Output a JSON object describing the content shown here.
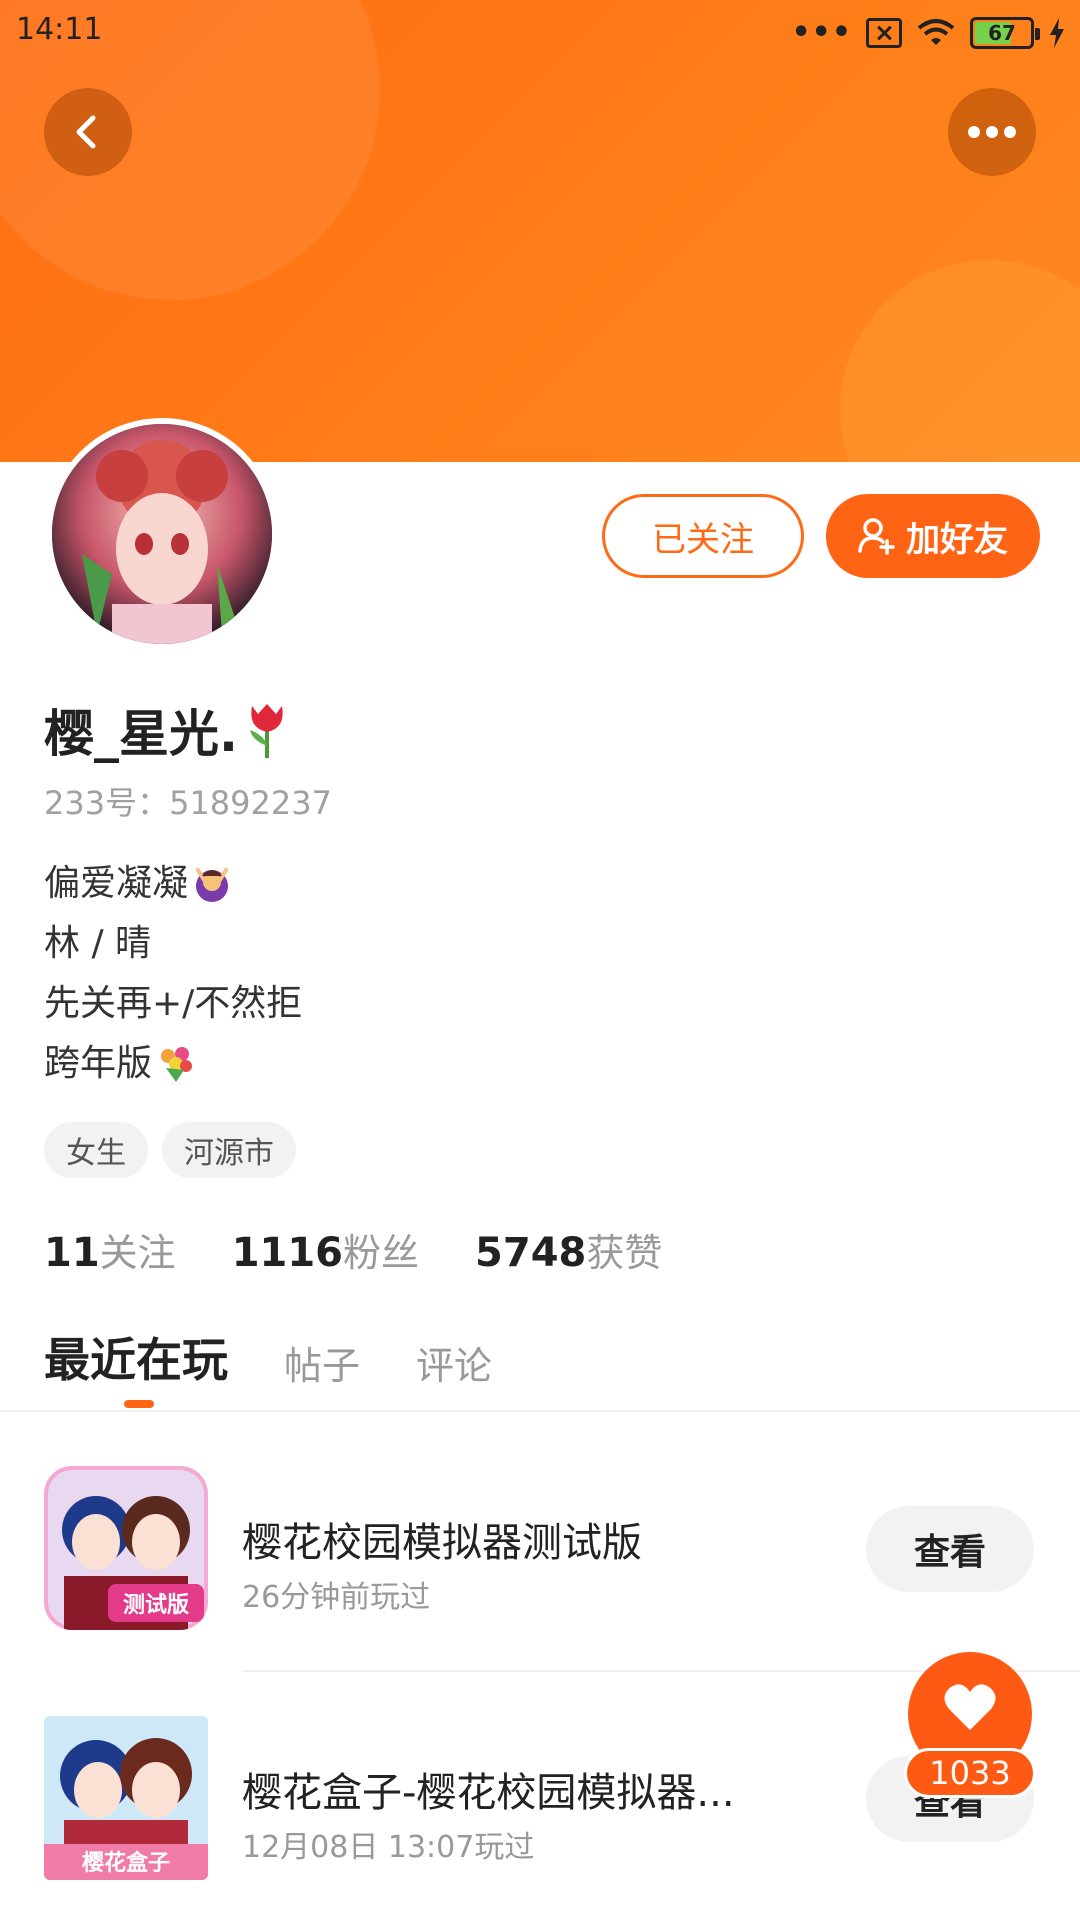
{
  "status_bar": {
    "time": "14:11",
    "battery": "67",
    "signal_dots": "•••"
  },
  "profile": {
    "name": "樱_星光.",
    "id_line": "233号：51892237",
    "bio": [
      "偏爱凝凝",
      "林 / 晴",
      "先关再+/不然拒",
      "跨年版"
    ],
    "tags": [
      "女生",
      "河源市"
    ],
    "follow_label": "已关注",
    "add_friend_label": "加好友"
  },
  "stats": {
    "following": {
      "num": "11",
      "label": "关注"
    },
    "followers": {
      "num": "1116",
      "label": "粉丝"
    },
    "likes": {
      "num": "5748",
      "label": "获赞"
    }
  },
  "tabs": [
    "最近在玩",
    "帖子",
    "评论"
  ],
  "games": [
    {
      "title": "樱花校园模拟器测试版",
      "subtitle": "26分钟前玩过",
      "button": "查看",
      "badge": "测试版"
    },
    {
      "title": "樱花盒子-樱花校园模拟器...",
      "subtitle": "12月08日 13:07玩过",
      "button": "查看",
      "badge": "樱花盒子"
    }
  ],
  "like_fab": {
    "count": "1033"
  },
  "colors": {
    "accent": "#ff6414",
    "banner": "#ff7a18"
  }
}
